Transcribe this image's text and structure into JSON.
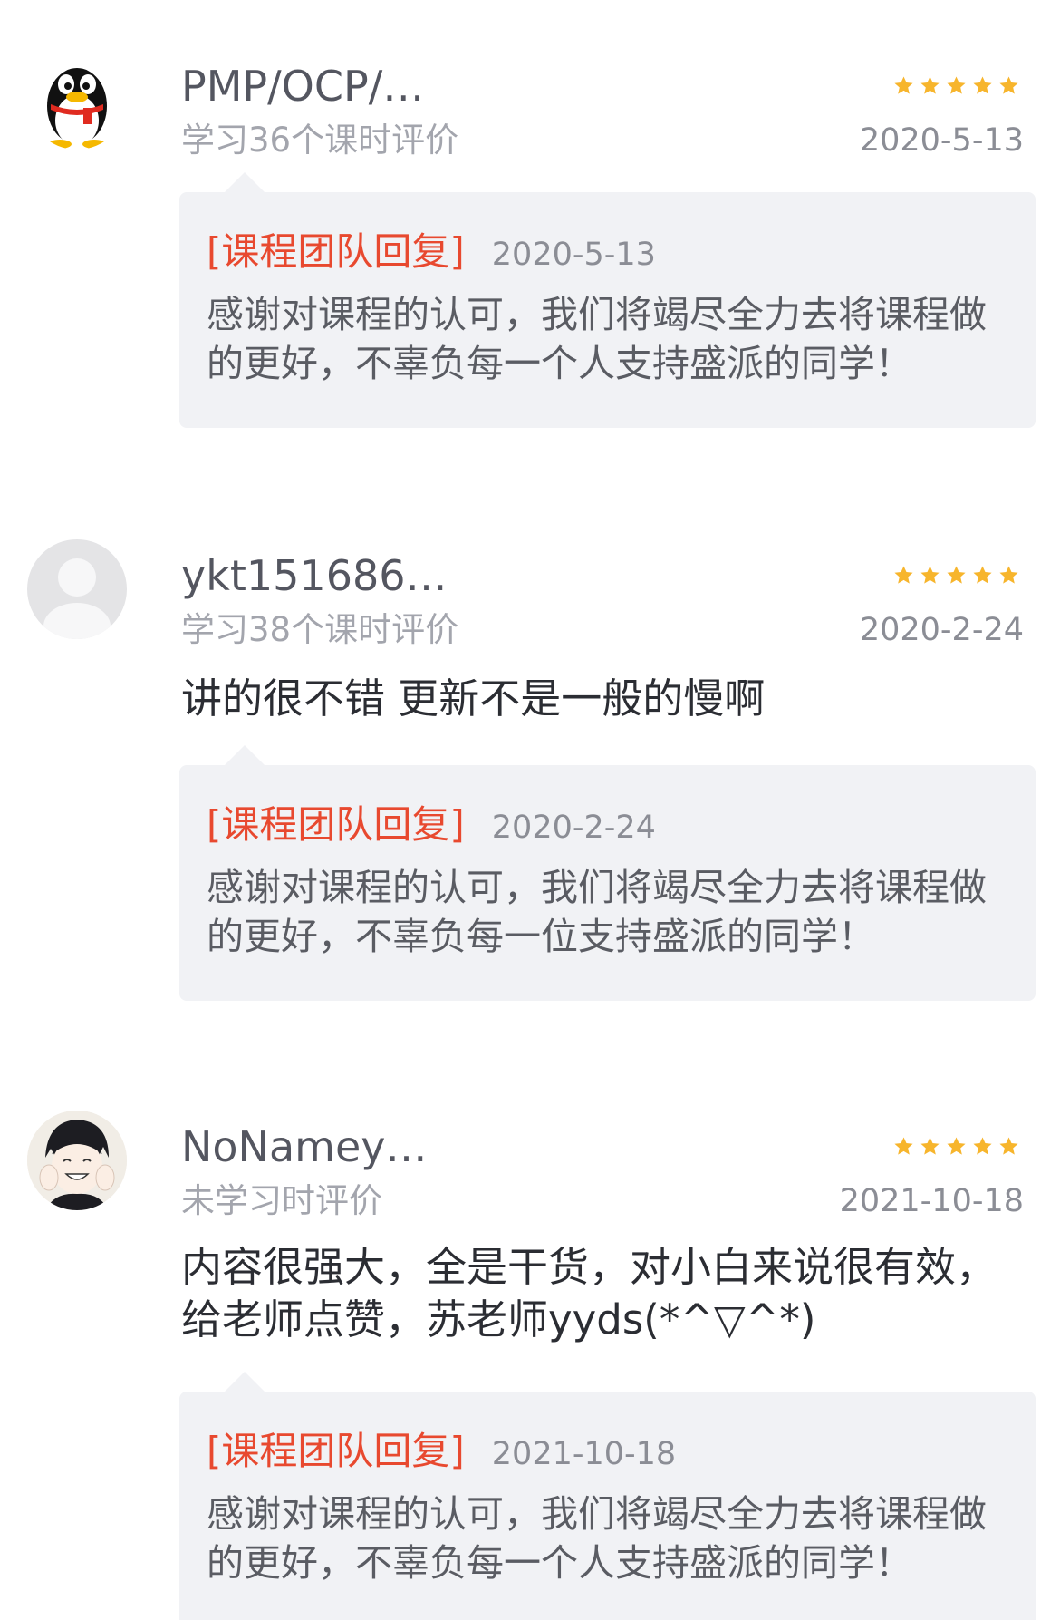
{
  "reviews": [
    {
      "username": "PMP/OCP/…",
      "avatar": "qq-penguin-avatar",
      "rating": 5,
      "study_info": "学习36个课时评价",
      "date": "2020-5-13",
      "comment": "",
      "reply": {
        "label": "[课程团队回复]",
        "date": "2020-5-13",
        "text": "感谢对课程的认可，我们将竭尽全力去将课程做的更好，不辜负每一个人支持盛派的同学！"
      }
    },
    {
      "username": "ykt151686…",
      "avatar": "default-user-avatar",
      "rating": 5,
      "study_info": "学习38个课时评价",
      "date": "2020-2-24",
      "comment": "讲的很不错 更新不是一般的慢啊",
      "reply": {
        "label": "[课程团队回复]",
        "date": "2020-2-24",
        "text": "感谢对课程的认可，我们将竭尽全力去将课程做的更好，不辜负每一位支持盛派的同学！"
      }
    },
    {
      "username": "NoNamey…",
      "avatar": "anime-boy-avatar",
      "rating": 5,
      "study_info": "未学习时评价",
      "date": "2021-10-18",
      "comment": "内容很强大，全是干货，对小白来说很有效，给老师点赞，苏老师yyds(*^▽^*)",
      "reply": {
        "label": "[课程团队回复]",
        "date": "2021-10-18",
        "text": "感谢对课程的认可，我们将竭尽全力去将课程做的更好，不辜负每一个人支持盛派的同学！"
      }
    }
  ],
  "colors": {
    "star": "#f7b52c",
    "reply_label": "#e8492f",
    "reply_bg": "#f1f2f5"
  }
}
